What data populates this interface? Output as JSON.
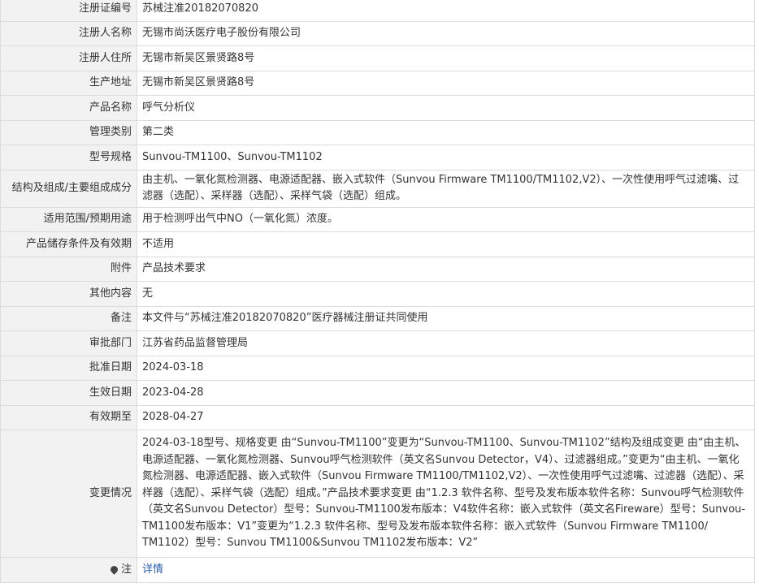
{
  "rows": [
    {
      "label": "注册证编号",
      "value": "苏械注准20182070820"
    },
    {
      "label": "注册人名称",
      "value": "无锡市尚沃医疗电子股份有限公司"
    },
    {
      "label": "注册人住所",
      "value": "无锡市新吴区景贤路8号"
    },
    {
      "label": "生产地址",
      "value": "无锡市新吴区景贤路8号"
    },
    {
      "label": "产品名称",
      "value": "呼气分析仪"
    },
    {
      "label": "管理类别",
      "value": "第二类"
    },
    {
      "label": "型号规格",
      "value": "Sunvou-TM1100、Sunvou-TM1102"
    },
    {
      "label": "结构及组成/主要组成成分",
      "value": "由主机、一氧化氮检测器、电源适配器、嵌入式软件（Sunvou Firmware TM1100/TM1102,V2）、一次性使用呼气过滤嘴、过滤器（选配）、采样器（选配）、采样气袋（选配）组成。"
    },
    {
      "label": "适用范围/预期用途",
      "value": "用于检测呼出气中NO（一氧化氮）浓度。"
    },
    {
      "label": "产品储存条件及有效期",
      "value": "不适用"
    },
    {
      "label": "附件",
      "value": "产品技术要求"
    },
    {
      "label": "其他内容",
      "value": "无"
    },
    {
      "label": "备注",
      "value": "本文件与“苏械注准20182070820”医疗器械注册证共同使用"
    },
    {
      "label": "审批部门",
      "value": "江苏省药品监督管理局"
    },
    {
      "label": "批准日期",
      "value": "2024-03-18"
    },
    {
      "label": "生效日期",
      "value": "2023-04-28"
    },
    {
      "label": "有效期至",
      "value": "2028-04-27"
    },
    {
      "label": "变更情况",
      "value": "2024-03-18型号、规格变更 由“Sunvou-TM1100”变更为“Sunvou-TM1100、Sunvou-TM1102”结构及组成变更 由“由主机、电源适配器、一氧化氮检测器、Sunvou呼气检测软件（英文名Sunvou Detector，V4）、过滤器组成。”变更为“由主机、一氧化氮检测器、电源适配器、嵌入式软件（Sunvou Firmware TM1100/TM1102,V2）、一次性使用呼气过滤嘴、过滤器（选配）、采样器（选配）、采样气袋（选配）组成。”产品技术要求变更 由“1.2.3 软件名称、型号及发布版本软件名称：Sunvou呼气检测软件（英文名Sunvou Detector）型号：Sunvou-TM1100发布版本：V4软件名称：嵌入式软件（英文名Fireware）型号：Sunvou-TM1100发布版本：V1”变更为“1.2.3 软件名称、型号及发布版本软件名称：嵌入式软件（Sunvou Firmware TM1100/ TM1102）型号：Sunvou TM1100&Sunvou TM1102发布版本：V2”"
    }
  ],
  "note": {
    "label": "注",
    "icon": "pin-icon",
    "link": "详情"
  }
}
